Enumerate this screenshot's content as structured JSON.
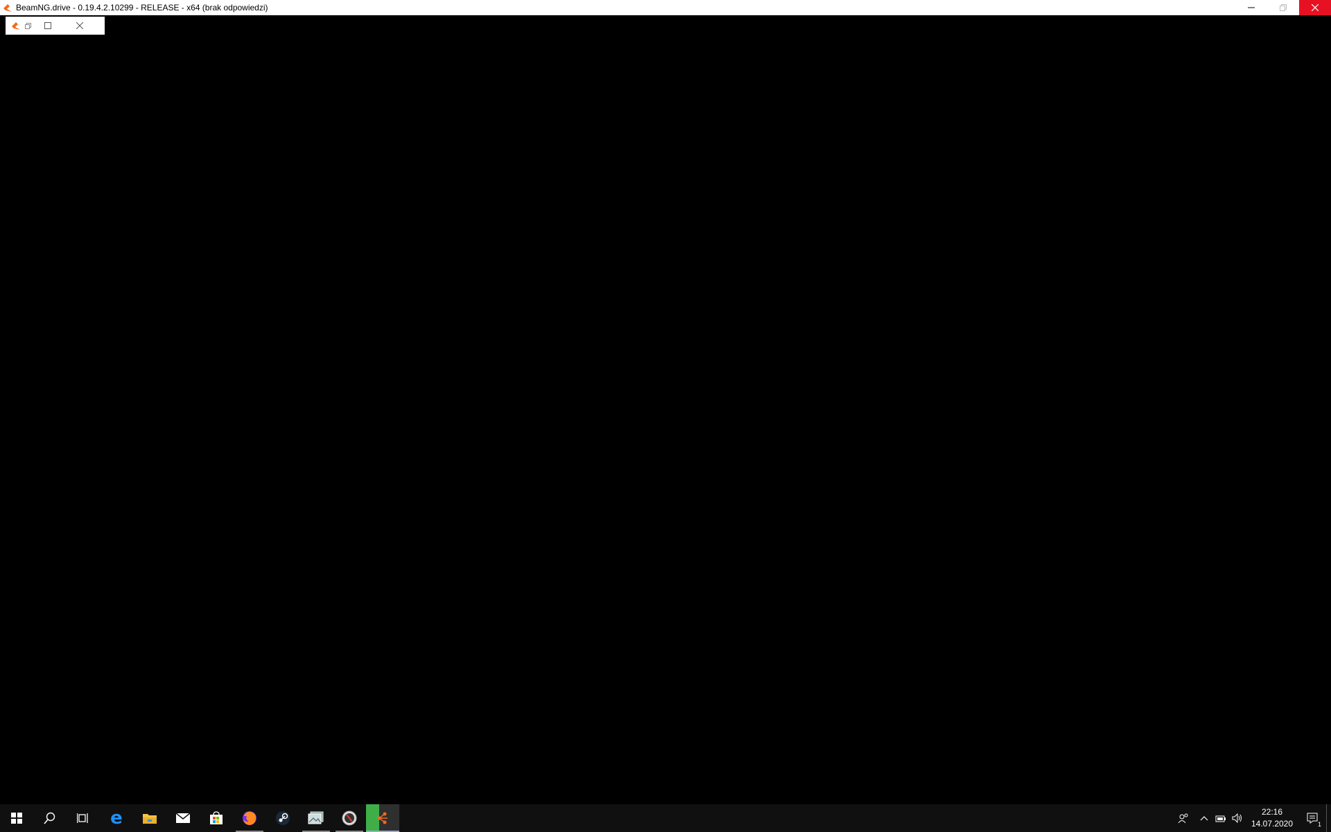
{
  "window": {
    "title": "BeamNG.drive - 0.19.4.2.10299 - RELEASE - x64 (brak odpowiedzi)",
    "app_icon": "beamng-icon",
    "controls": [
      "minimize",
      "restore",
      "close"
    ]
  },
  "mini_window": {
    "icons": [
      "beamng-icon",
      "restore-icon",
      "maximize-icon",
      "close-icon"
    ]
  },
  "taskbar": {
    "items": [
      {
        "name": "start",
        "icon": "windows-logo-icon"
      },
      {
        "name": "search",
        "icon": "search-icon"
      },
      {
        "name": "task-view",
        "icon": "task-view-icon"
      },
      {
        "name": "edge",
        "icon": "edge-icon"
      },
      {
        "name": "file-explorer",
        "icon": "folder-icon"
      },
      {
        "name": "mail",
        "icon": "mail-icon"
      },
      {
        "name": "store",
        "icon": "store-icon"
      },
      {
        "name": "firefox",
        "icon": "firefox-icon"
      },
      {
        "name": "steam",
        "icon": "steam-icon"
      },
      {
        "name": "photos",
        "icon": "photos-icon"
      },
      {
        "name": "app-circle",
        "icon": "compass-icon"
      },
      {
        "name": "beamng",
        "icon": "beamng-icon"
      }
    ],
    "tray": {
      "time": "22:16",
      "date": "14.07.2020",
      "notification_count": "1"
    }
  },
  "colors": {
    "close_button": "#e81123",
    "taskbar_bg": "#101010",
    "beamng_orange": "#f26b1d",
    "beamng_green": "#3fae49"
  }
}
